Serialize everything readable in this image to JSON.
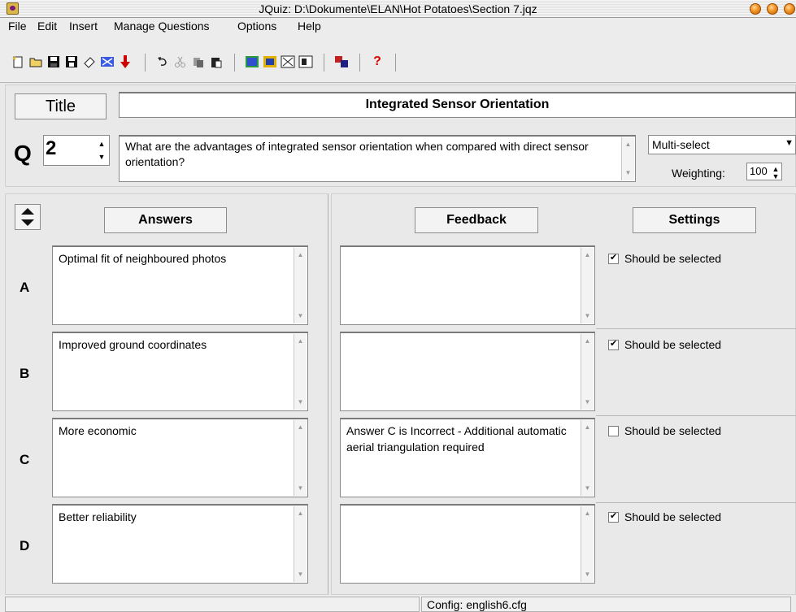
{
  "window": {
    "title": "JQuiz: D:\\Dokumente\\ELAN\\Hot Potatoes\\Section 7.jqz"
  },
  "menu": [
    "File",
    "Edit",
    "Insert",
    "Manage Questions",
    "Options",
    "Help"
  ],
  "title_section": {
    "button_label": "Title",
    "value": "Integrated Sensor Orientation"
  },
  "question": {
    "prefix": "Q",
    "number": "2",
    "text": "What are the advantages of integrated sensor orientation when compared with direct sensor orientation?",
    "type": "Multi-select",
    "weighting_label": "Weighting:",
    "weighting_value": "100"
  },
  "headers": {
    "answers": "Answers",
    "feedback": "Feedback",
    "settings": "Settings"
  },
  "rows": [
    {
      "letter": "A",
      "answer": "Optimal fit of neighboured photos",
      "feedback": "",
      "setting_label": "Should be selected",
      "checked": true
    },
    {
      "letter": "B",
      "answer": "Improved ground coordinates",
      "feedback": "",
      "setting_label": "Should be selected",
      "checked": true
    },
    {
      "letter": "C",
      "answer": "More economic",
      "feedback": "Answer C is Incorrect - Additional automatic aerial triangulation required",
      "setting_label": "Should be selected",
      "checked": false
    },
    {
      "letter": "D",
      "answer": "Better reliability",
      "feedback": "",
      "setting_label": "Should be selected",
      "checked": true
    }
  ],
  "status": {
    "config": "Config: english6.cfg"
  },
  "icons": {
    "toolbar": [
      "new-file-icon",
      "open-folder-icon",
      "save-icon",
      "save-as-icon",
      "clear-icon",
      "web-page-icon",
      "export-down-icon",
      "undo-icon",
      "cut-icon",
      "copy-icon",
      "paste-icon",
      "export-1-icon",
      "export-2-icon",
      "export-3-icon",
      "export-4-icon",
      "masher-icon",
      "help-icon"
    ]
  }
}
